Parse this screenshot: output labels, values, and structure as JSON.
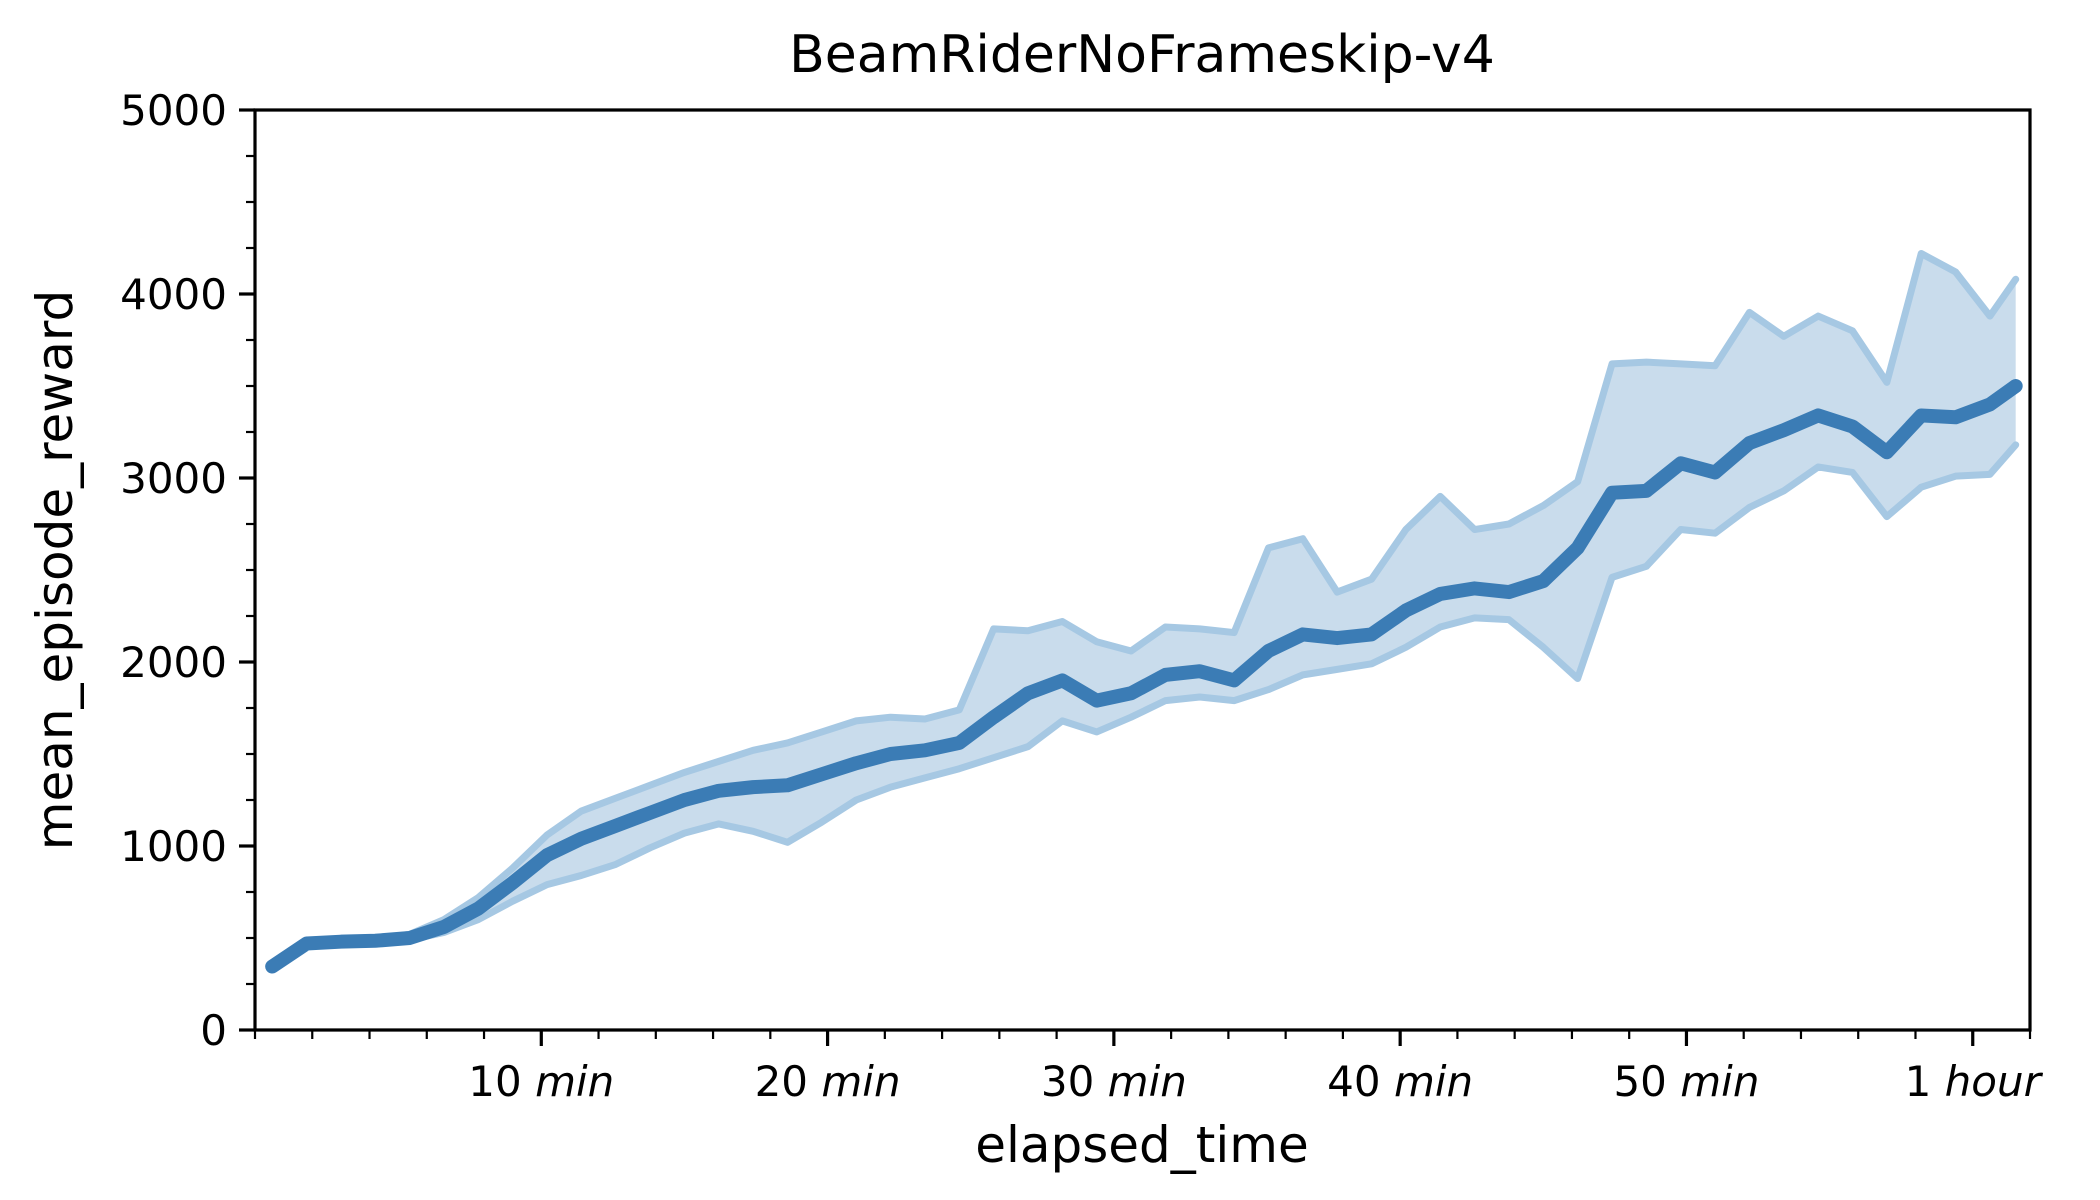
{
  "chart_data": {
    "type": "line",
    "title": "BeamRiderNoFrameskip-v4",
    "xlabel": "elapsed_time",
    "ylabel": "mean_episode_reward",
    "grid": false,
    "legend": false,
    "legend_position": "none",
    "xlim": [
      0,
      62
    ],
    "ylim": [
      0,
      5000
    ],
    "x_unit": "minutes",
    "y_ticks": [
      0,
      1000,
      2000,
      3000,
      4000,
      5000
    ],
    "y_tick_labels": [
      "0",
      "1000",
      "2000",
      "3000",
      "4000",
      "5000"
    ],
    "x_ticks": [
      10,
      20,
      30,
      40,
      50,
      60
    ],
    "x_tick_labels": [
      "10 min",
      "20 min",
      "30 min",
      "40 min",
      "50 min",
      "1 hour"
    ],
    "x_tick_label_parts": [
      {
        "number": "10",
        "unit": "min"
      },
      {
        "number": "20",
        "unit": "min"
      },
      {
        "number": "30",
        "unit": "min"
      },
      {
        "number": "40",
        "unit": "min"
      },
      {
        "number": "50",
        "unit": "min"
      },
      {
        "number": "1",
        "unit": "hour"
      }
    ],
    "colors": {
      "line": "#3b7cb5",
      "band_fill": "#c9dcec",
      "band_edge": "#a6c8e3",
      "axis": "#000000",
      "background": "#ffffff"
    },
    "x": [
      0.6,
      1.8,
      3.0,
      4.2,
      5.4,
      6.6,
      7.8,
      9.0,
      10.2,
      11.4,
      12.6,
      13.8,
      15.0,
      16.2,
      17.4,
      18.6,
      19.8,
      21.0,
      22.2,
      23.4,
      24.6,
      25.8,
      27.0,
      28.2,
      29.4,
      30.6,
      31.8,
      33.0,
      34.2,
      35.4,
      36.6,
      37.8,
      39.0,
      40.2,
      41.4,
      42.6,
      43.8,
      45.0,
      46.2,
      47.4,
      48.6,
      49.8,
      51.0,
      52.2,
      53.4,
      54.6,
      55.8,
      57.0,
      58.2,
      59.4,
      60.6,
      61.5
    ],
    "series": [
      {
        "name": "mean_episode_reward",
        "values": [
          345,
          470,
          480,
          485,
          500,
          560,
          660,
          800,
          950,
          1040,
          1110,
          1180,
          1250,
          1300,
          1320,
          1330,
          1390,
          1450,
          1500,
          1520,
          1560,
          1700,
          1830,
          1900,
          1790,
          1830,
          1930,
          1950,
          1900,
          2060,
          2150,
          2130,
          2150,
          2280,
          2370,
          2400,
          2380,
          2440,
          2620,
          2920,
          2930,
          3080,
          3030,
          3190,
          3260,
          3340,
          3280,
          3140,
          3340,
          3330,
          3400,
          3500
        ],
        "band_lower": [
          345,
          470,
          480,
          480,
          490,
          530,
          600,
          700,
          790,
          840,
          900,
          990,
          1070,
          1120,
          1080,
          1020,
          1130,
          1250,
          1320,
          1370,
          1420,
          1480,
          1540,
          1680,
          1620,
          1700,
          1790,
          1810,
          1790,
          1850,
          1930,
          1960,
          1990,
          2080,
          2190,
          2240,
          2230,
          2080,
          1910,
          2460,
          2520,
          2720,
          2700,
          2840,
          2930,
          3060,
          3030,
          2790,
          2950,
          3010,
          3020,
          3180
        ],
        "band_upper": [
          345,
          470,
          485,
          495,
          520,
          600,
          720,
          880,
          1060,
          1190,
          1260,
          1330,
          1400,
          1460,
          1520,
          1560,
          1620,
          1680,
          1700,
          1690,
          1740,
          2180,
          2170,
          2220,
          2110,
          2060,
          2190,
          2180,
          2160,
          2620,
          2670,
          2380,
          2450,
          2720,
          2900,
          2720,
          2750,
          2850,
          2980,
          3620,
          3630,
          3620,
          3610,
          3900,
          3770,
          3880,
          3800,
          3520,
          4220,
          4120,
          3880,
          4080
        ]
      }
    ],
    "final_values": {
      "mean": 3900,
      "lower": 3500,
      "upper": 4300
    }
  }
}
